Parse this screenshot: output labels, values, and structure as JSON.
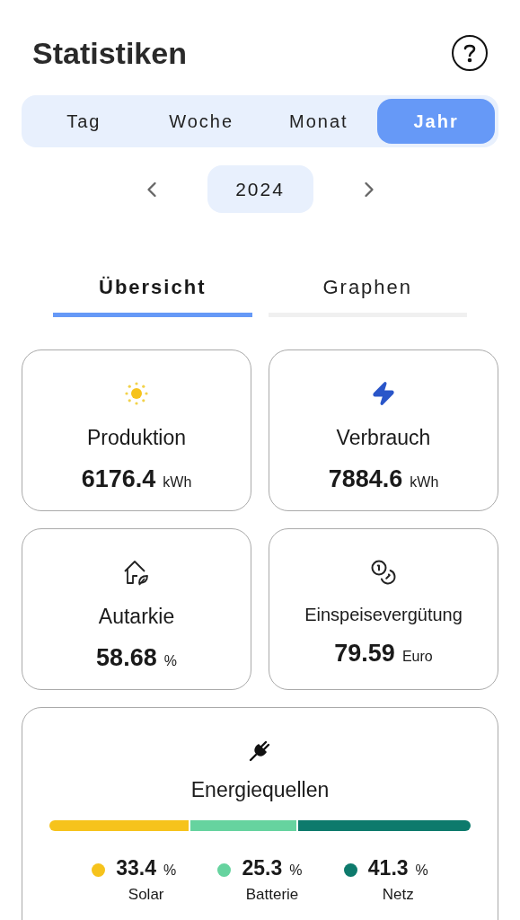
{
  "title": "Statistiken",
  "periods": [
    {
      "label": "Tag",
      "selected": false
    },
    {
      "label": "Woche",
      "selected": false
    },
    {
      "label": "Monat",
      "selected": false
    },
    {
      "label": "Jahr",
      "selected": true
    }
  ],
  "year": "2024",
  "views": [
    {
      "label": "Übersicht",
      "selected": true
    },
    {
      "label": "Graphen",
      "selected": false
    }
  ],
  "cards": [
    {
      "kind": "sun",
      "label": "Produktion",
      "value": "6176.4",
      "unit": "kWh"
    },
    {
      "kind": "bolt",
      "label": "Verbrauch",
      "value": "7884.6",
      "unit": "kWh"
    },
    {
      "kind": "house",
      "label": "Autarkie",
      "value": "58.68",
      "unit": "%"
    },
    {
      "kind": "coins",
      "label": "Einspeisevergütung",
      "value": "79.59",
      "unit": "Euro"
    }
  ],
  "sources": {
    "label": "Energiequellen",
    "items": [
      {
        "name": "Solar",
        "value": "33.4",
        "unit": "%",
        "color": "#f6c31c"
      },
      {
        "name": "Batterie",
        "value": "25.3",
        "unit": "%",
        "color": "#66d39f"
      },
      {
        "name": "Netz",
        "value": "41.3",
        "unit": "%",
        "color": "#0d7a6c"
      }
    ]
  }
}
